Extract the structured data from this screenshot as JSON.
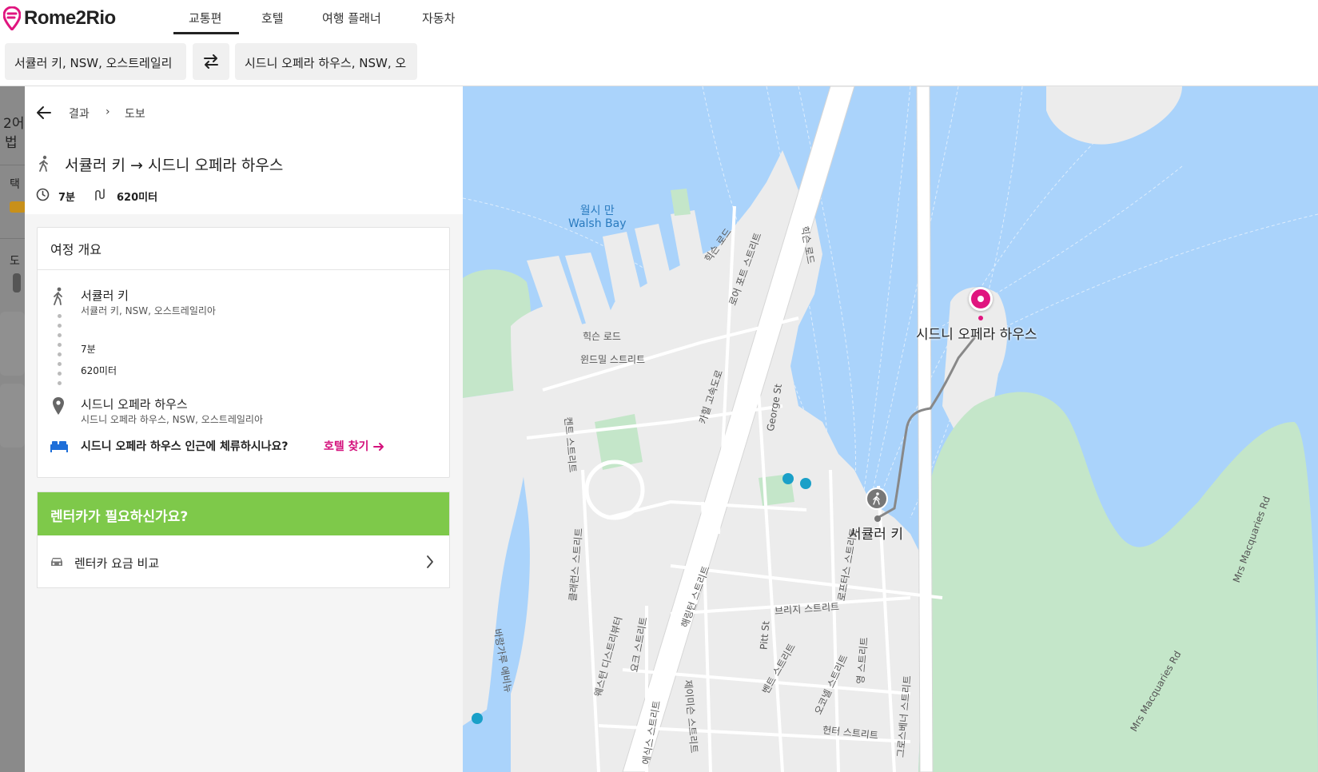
{
  "header": {
    "logo_text": "Rome2Rio",
    "nav": [
      "교통편",
      "호텔",
      "여행 플래너",
      "자동차"
    ],
    "active_tab": "교통편"
  },
  "search": {
    "origin": "서큘러 키, NSW, 오스트레일리",
    "destination": "시드니 오페라 하우스, NSW, 오"
  },
  "backdrop": {
    "t1": "2어",
    "t2": "법",
    "t3": "택",
    "t4": "도"
  },
  "panel": {
    "breadcrumb_results": "결과",
    "breadcrumb_sep": "›",
    "breadcrumb_current": "도보",
    "title": "서큘러 키 → 시드니 오페라 하우스",
    "duration": "7분",
    "distance": "620미터"
  },
  "itinerary": {
    "heading": "여정 개요",
    "from_name": "서큘러 키",
    "from_sub": "서큘러 키, NSW, 오스트레일리아",
    "leg_duration": "7분",
    "leg_distance": "620미터",
    "to_name": "시드니 오페라 하우스",
    "to_sub": "시드니 오페라 하우스, NSW, 오스트레일리아",
    "hotel_question": "시드니 오페라 하우스 인근에 체류하시나요?",
    "hotel_link": "호텔 찾기"
  },
  "rental": {
    "title": "렌터카가 필요하신가요?",
    "compare": "렌터카 요금 비교"
  },
  "map": {
    "water_label_ko": "월시 만",
    "water_label_en": "Walsh Bay",
    "dest_label": "시드니 오페라 하우스",
    "origin_label": "서큘러 키",
    "streets": {
      "hickson": "힉슨 로드",
      "windmill": "윈드밀 스트리트",
      "george": "George St",
      "pitt": "Pitt St",
      "bridge": "브리지 스트리트",
      "kent": "켄트 스트리트",
      "cahill": "카힐 고속도로",
      "macquaries": "Mrs Macquaries Rd",
      "macquaries2": "Mrs Macquaries Rd",
      "lower_fort": "로어 포트 스트리트",
      "hickson2": "힉슨 로드",
      "hickson3": "힉슨 로드",
      "west_distributor": "웨스턴 디스트리뷰터",
      "loftus": "로프터스 스트리트",
      "york": "요크 스트리트",
      "clarence": "클래런스 스트리트",
      "young": "영 스트리트",
      "bent": "벤트 스트리트",
      "o_connell": "오코넬 스트리트",
      "hunter": "헌터 스트리트",
      "barangaroo": "바랑가루 애비뉴",
      "jamison": "제이미슨 스트리트",
      "grosvenor": "그로스베너 스트리트",
      "harrington": "해링턴 스트리트",
      "essex": "에식스 스트리트"
    }
  },
  "colors": {
    "accent": "#d4117c",
    "green_banner": "#7ec94a",
    "water": "#aad3fb",
    "park": "#c4e6c9",
    "land": "#ececec"
  }
}
